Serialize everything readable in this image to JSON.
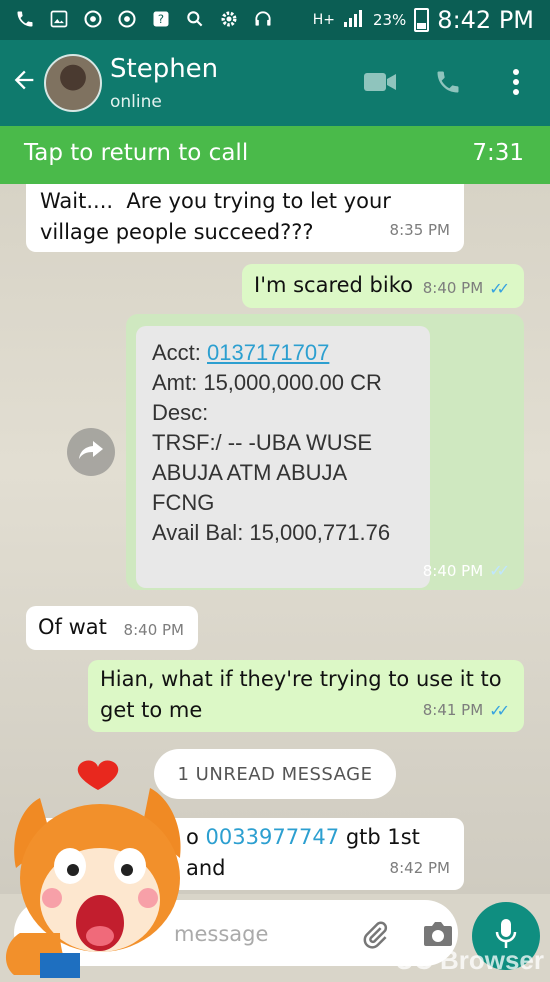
{
  "status_bar": {
    "network": "H+",
    "battery_percent": "23%",
    "time": "8:42 PM",
    "icons": [
      "phone-icon",
      "image-icon",
      "chrome-icon",
      "chrome-icon",
      "help-icon",
      "search-icon",
      "gear-icon",
      "headset-icon"
    ]
  },
  "header": {
    "contact_name": "Stephen",
    "status": "online",
    "back_icon": "arrow-left-icon",
    "actions": [
      "video-call-icon",
      "phone-icon",
      "more-vert-icon"
    ]
  },
  "call_banner": {
    "label": "Tap to return to call",
    "timer": "7:31"
  },
  "messages": [
    {
      "direction": "incoming",
      "text": "Wait....  Are you trying to let your\nvillage people succeed???",
      "time": "8:35 PM"
    },
    {
      "direction": "outgoing",
      "text": "I'm scared biko",
      "time": "8:40 PM",
      "read": true
    },
    {
      "direction": "outgoing",
      "type": "image",
      "time": "8:40 PM",
      "read": true,
      "image_text": {
        "acct_label": "Acct: ",
        "acct_number": "0137171707",
        "amt": "Amt: 15,000,000.00 CR",
        "desc": "Desc:",
        "trsf_line1": "TRSF:/ -- -UBA WUSE",
        "trsf_line2": "ABUJA ATM ABUJA",
        "trsf_line3": "FCNG",
        "avail": "Avail Bal: 15,000,771.76"
      }
    },
    {
      "direction": "incoming",
      "text": "Of wat",
      "time": "8:40 PM"
    },
    {
      "direction": "outgoing",
      "text": "Hian, what if they're trying to use it to\nget to me",
      "time": "8:41 PM",
      "read": true
    },
    {
      "direction": "incoming",
      "text_link": "0033977747",
      "text_rest": " gtb 1st and",
      "text_prefix": "o ",
      "time": "8:42 PM"
    }
  ],
  "unread_banner": "1 UNREAD MESSAGE",
  "composer": {
    "placeholder": "message",
    "icons": [
      "attach-icon",
      "camera-icon",
      "mic-icon"
    ]
  },
  "watermark": "UC Browser",
  "colors": {
    "status_bar": "#0b5e54",
    "app_bar": "#0f7a6d",
    "call_banner": "#4aba4a",
    "outgoing_bubble": "#dcf8c6",
    "incoming_bubble": "#ffffff",
    "read_ticks": "#36a2e0"
  }
}
